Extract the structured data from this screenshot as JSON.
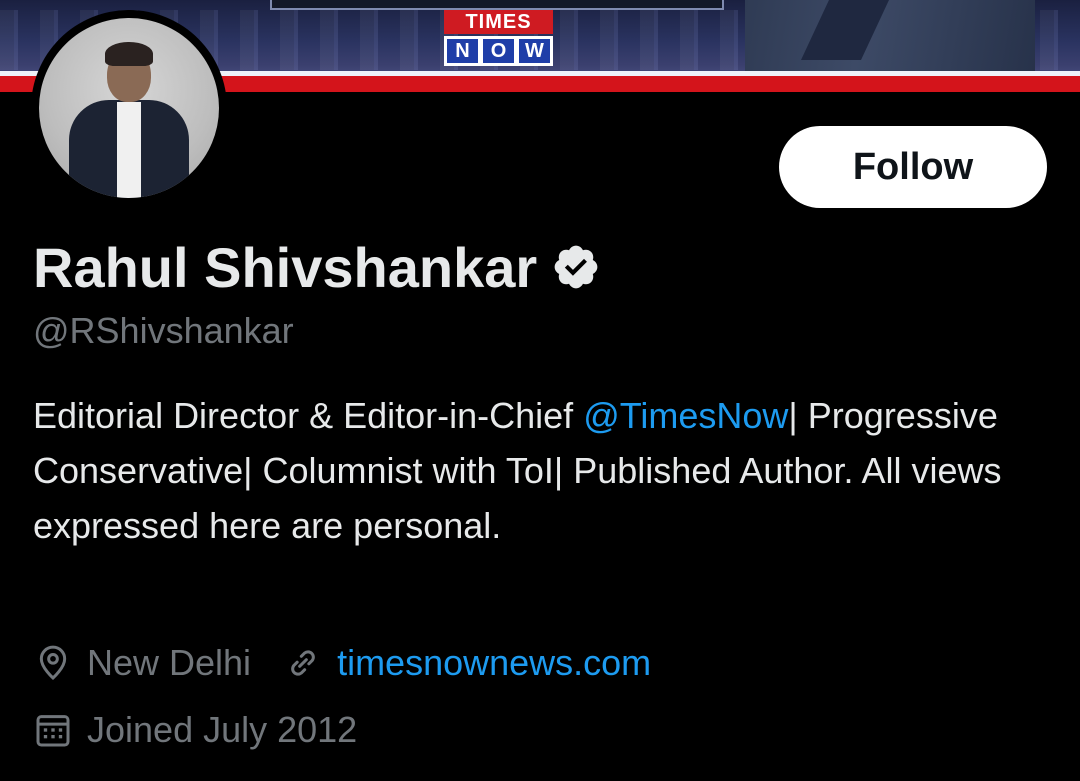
{
  "banner": {
    "logo_top": "TIMES",
    "logo_bottom": [
      "N",
      "O",
      "W"
    ]
  },
  "profile": {
    "name": "Rahul Shivshankar",
    "handle": "@RShivshankar",
    "follow_label": "Follow",
    "bio_part1": "Editorial Director & Editor-in-Chief ",
    "bio_mention": "@TimesNow",
    "bio_part2": "| Progressive Conservative| Columnist with ToI| Published Author. All views expressed here are personal.",
    "location": "New Delhi",
    "website": "timesnownews.com",
    "joined": "Joined July 2012"
  },
  "icons": {
    "verified": "verified-badge-icon",
    "location": "location-pin-icon",
    "link": "link-icon",
    "calendar": "calendar-icon"
  },
  "colors": {
    "accent": "#1d9bf0",
    "muted": "#71767b",
    "text": "#e7e9ea",
    "background": "#000000"
  }
}
